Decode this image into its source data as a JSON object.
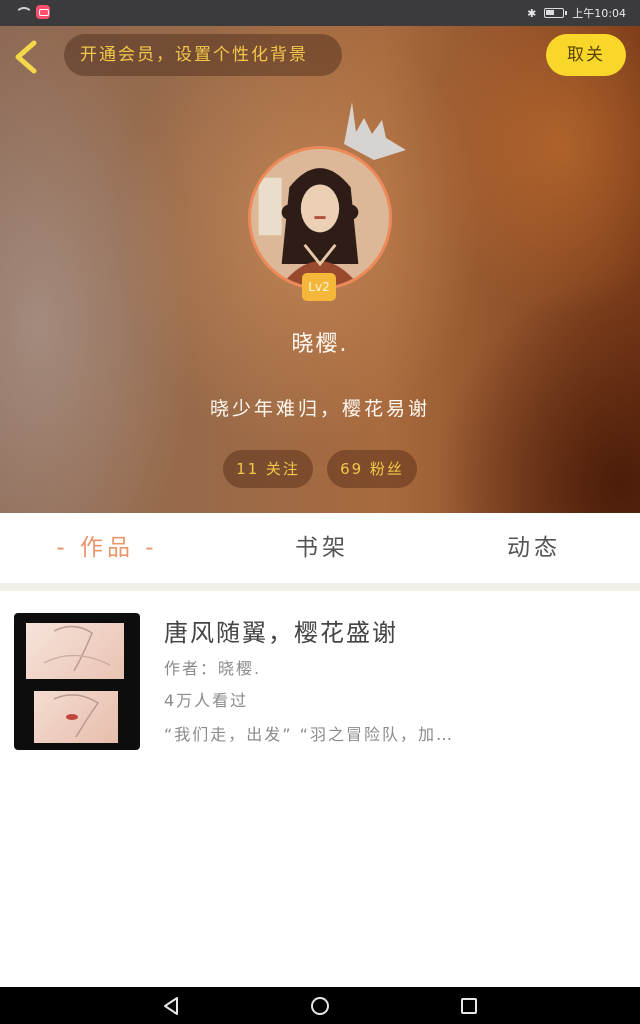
{
  "status_bar": {
    "time": "上午10:04"
  },
  "header": {
    "vip_prompt": "开通会员，设置个性化背景",
    "follow_button": "取关"
  },
  "profile": {
    "level": "Lv2",
    "username": "晓樱.",
    "bio": "晓少年难归，樱花易谢",
    "following": "11 关注",
    "fans": "69 粉丝"
  },
  "tabs": {
    "works": "- 作品 -",
    "shelf": "书架",
    "moments": "动态"
  },
  "work": {
    "title": "唐风随翼，樱花盛谢",
    "author": "作者：晓樱.",
    "views": "4万人看过",
    "excerpt": "“我们走，出发” “羽之冒险队，加…"
  },
  "colors": {
    "accent_orange": "#e8956a",
    "vip_text": "#f3c84a",
    "follow_button": "#f8d62a",
    "level_badge": "#f5b73a"
  }
}
